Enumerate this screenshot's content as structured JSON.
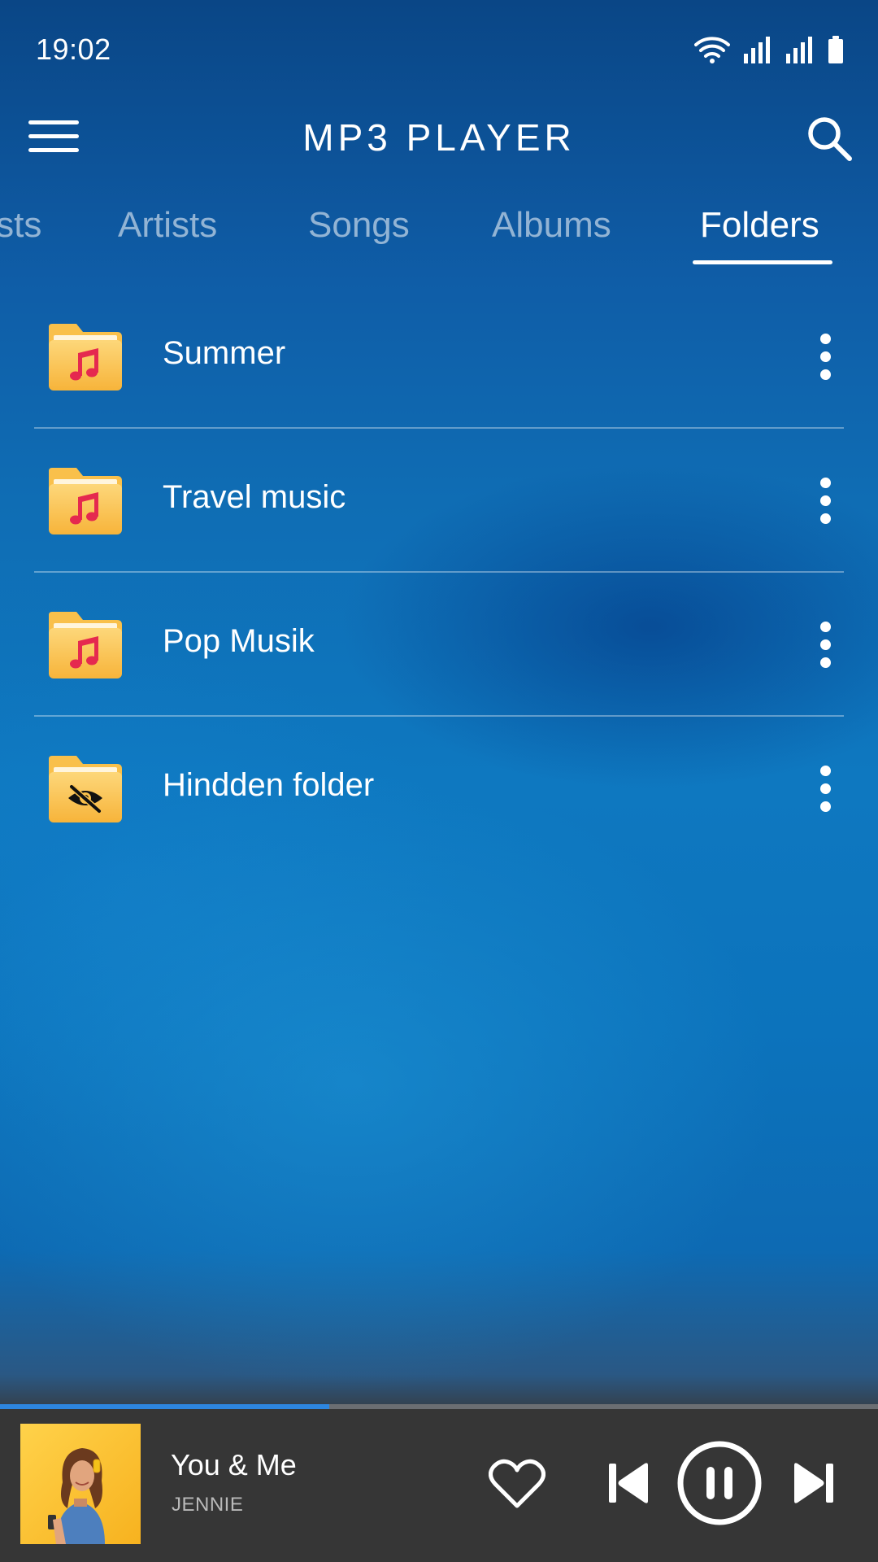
{
  "status_bar": {
    "time": "19:02",
    "icons": [
      "wifi-icon",
      "signal-icon",
      "signal-icon",
      "battery-icon"
    ]
  },
  "app_bar": {
    "title": "MP3 PLAYER",
    "menu_icon": "menu-icon",
    "search_icon": "search-icon"
  },
  "tabs": [
    {
      "label": "Playlists",
      "visible_text": "ts",
      "active": false
    },
    {
      "label": "Artists",
      "active": false
    },
    {
      "label": "Songs",
      "active": false
    },
    {
      "label": "Albums",
      "active": false
    },
    {
      "label": "Folders",
      "active": true
    }
  ],
  "folders": [
    {
      "name": "Summer",
      "icon": "music-folder-icon"
    },
    {
      "name": "Travel music",
      "icon": "music-folder-icon"
    },
    {
      "name": "Pop Musik",
      "icon": "music-folder-icon"
    },
    {
      "name": "Hindden folder",
      "icon": "hidden-folder-icon"
    }
  ],
  "now_playing": {
    "title": "You & Me",
    "artist": "JENNIE",
    "progress": 0.375,
    "playing": true
  },
  "colors": {
    "accent": "#2d86e0",
    "player_bg": "#363636",
    "note": "#e5294f",
    "folder": "#fbc24c"
  }
}
